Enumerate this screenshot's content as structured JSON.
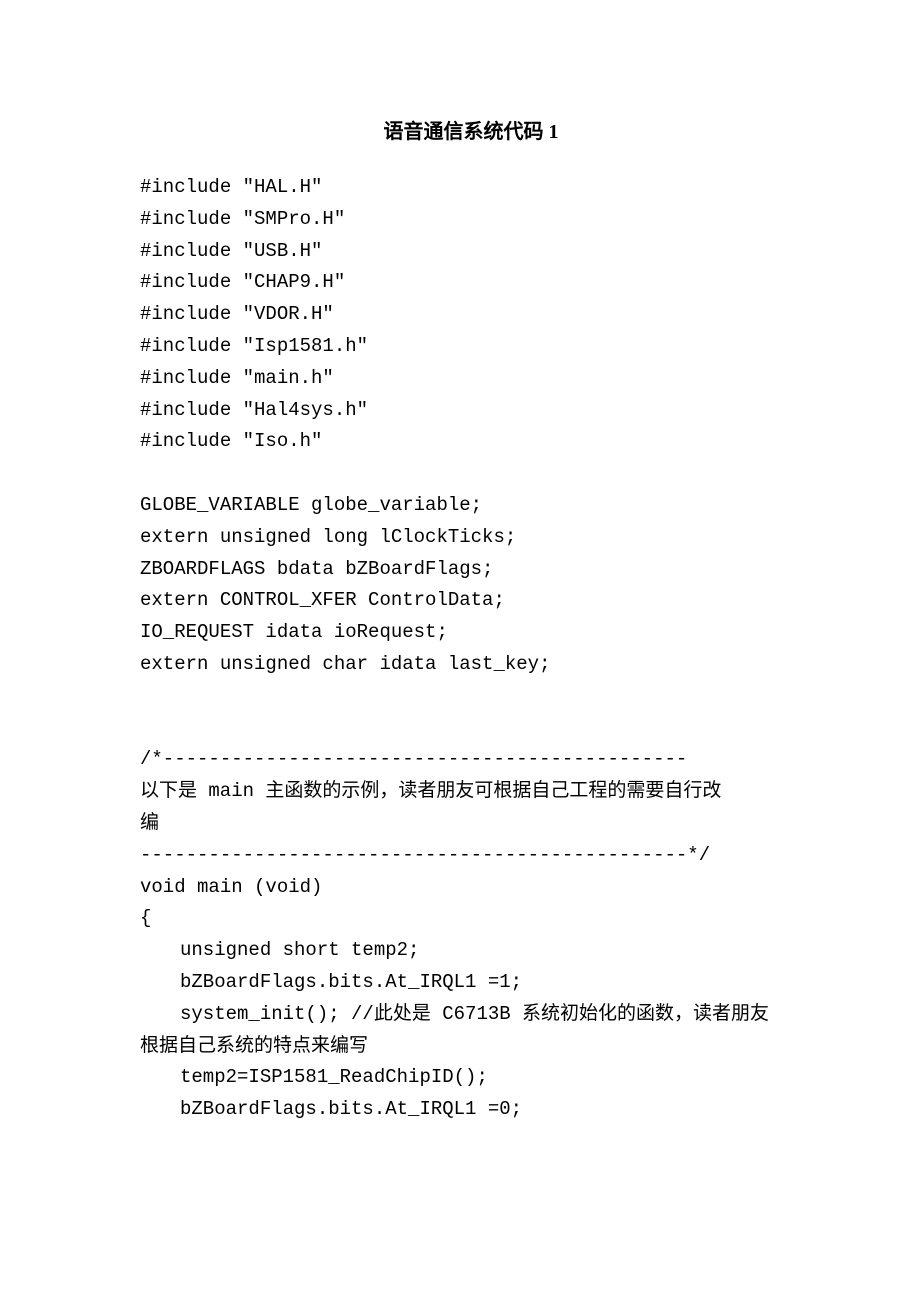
{
  "title": "语音通信系统代码 1",
  "code": {
    "inc1": "#include \"HAL.H\"",
    "inc2": "#include \"SMPro.H\"",
    "inc3": "#include \"USB.H\"",
    "inc4": "#include \"CHAP9.H\"",
    "inc5": "#include \"VDOR.H\"",
    "inc6": "#include \"Isp1581.h\"",
    "inc7": "#include \"main.h\"",
    "inc8": "#include \"Hal4sys.h\"",
    "inc9": "#include \"Iso.h\"",
    "decl1": "GLOBE_VARIABLE globe_variable;",
    "decl2": "extern unsigned long lClockTicks;",
    "decl3": "ZBOARDFLAGS bdata bZBoardFlags;",
    "decl4": "extern CONTROL_XFER ControlData;",
    "decl5": "IO_REQUEST idata ioRequest;",
    "decl6": "extern unsigned char idata last_key;",
    "cmt1": "/*----------------------------------------------",
    "cmt2a": "以下是 main 主函数的示例，读者朋友可根据自己工程的需要自行改",
    "cmt2b": "编",
    "cmt3": "------------------------------------------------*/",
    "main1": "void main (void)",
    "main2": "{",
    "body1": "unsigned short temp2;",
    "body2": "bZBoardFlags.bits.At_IRQL1 =1;",
    "body3a": "system_init();  //此处是 C6713B 系统初始化的函数，读者朋友",
    "body3b": "根据自己系统的特点来编写",
    "body4": "temp2=ISP1581_ReadChipID();",
    "body5": "bZBoardFlags.bits.At_IRQL1 =0;"
  }
}
